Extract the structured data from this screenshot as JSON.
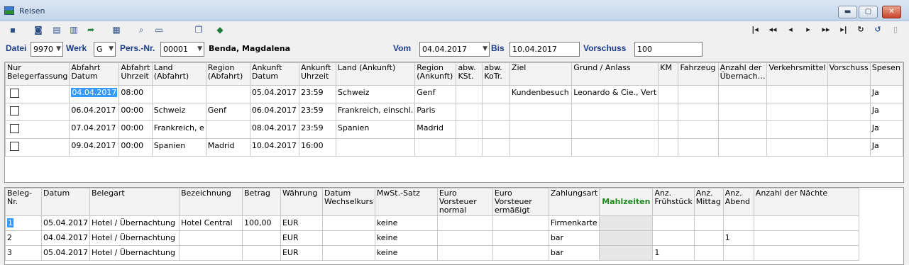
{
  "window": {
    "title": "Reisen",
    "minimize": "▬",
    "maximize": "▢",
    "close": "✕"
  },
  "toolbar": {
    "left_icons": [
      "save-icon",
      "preview-icon",
      "print-icon",
      "print-setup-icon",
      "export-icon",
      "calculator-icon",
      "search-icon",
      "form-icon",
      "copy-icon",
      "book-icon"
    ],
    "nav_icons": [
      "first-record-icon",
      "prev-page-icon",
      "prev-record-icon",
      "next-record-icon",
      "next-page-icon",
      "last-record-icon",
      "refresh-icon",
      "undo-icon",
      "delete-icon"
    ]
  },
  "filter": {
    "datei_label": "Datei",
    "datei_value": "9970",
    "werk_label": "Werk",
    "werk_value": "G",
    "persnr_label": "Pers.-Nr.",
    "persnr_value": "00001",
    "person_name": "Benda, Magdalena",
    "vom_label": "Vom",
    "vom_value": "04.04.2017",
    "bis_label": "Bis",
    "bis_value": "10.04.2017",
    "vorschuss_label": "Vorschuss",
    "vorschuss_value": "100"
  },
  "travel_table": {
    "headers": [
      "Nur Belegerfassung",
      "Abfahrt Datum",
      "Abfahrt Uhrzeit",
      "Land (Abfahrt)",
      "Region (Abfahrt)",
      "Ankunft Datum",
      "Ankunft Uhrzeit",
      "Land (Ankunft)",
      "Region (Ankunft)",
      "abw. KSt.",
      "abw. KoTr.",
      "Ziel",
      "Grund / Anlass",
      "KM",
      "Fahrzeug",
      "Anzahl der Übernach…",
      "Verkehrsmittel",
      "Vorschuss",
      "Spesen"
    ],
    "rows": [
      [
        "",
        "04.04.2017",
        "08:00",
        "",
        "",
        "05.04.2017",
        "23:59",
        "Schweiz",
        "Genf",
        "",
        "",
        "Kundenbesuch",
        "Leonardo & Cie., Vert",
        "",
        "",
        "",
        "",
        "",
        "Ja"
      ],
      [
        "",
        "06.04.2017",
        "00:00",
        "Schweiz",
        "Genf",
        "06.04.2017",
        "23:59",
        "Frankreich, einschl.",
        "Paris",
        "",
        "",
        "",
        "",
        "",
        "",
        "",
        "",
        "",
        "Ja"
      ],
      [
        "",
        "07.04.2017",
        "00:00",
        "Frankreich, e",
        "",
        "08.04.2017",
        "23:59",
        "Spanien",
        "Madrid",
        "",
        "",
        "",
        "",
        "",
        "",
        "",
        "",
        "",
        "Ja"
      ],
      [
        "",
        "09.04.2017",
        "00:00",
        "Spanien",
        "Madrid",
        "10.04.2017",
        "16:00",
        "",
        "",
        "",
        "",
        "",
        "",
        "",
        "",
        "",
        "",
        "",
        "Ja"
      ]
    ]
  },
  "receipt_table": {
    "headers": [
      "Beleg-Nr.",
      "Datum",
      "Belegart",
      "Bezeichnung",
      "Betrag",
      "Währung",
      "Datum Wechselkurs",
      "MwSt.-Satz",
      "Euro Vorsteuer normal",
      "Euro Vorsteuer ermäßigt",
      "Zahlungsart",
      "Mahlzeiten",
      "Anz. Frühstück",
      "Anz. Mittag",
      "Anz. Abend",
      "Anzahl der Nächte"
    ],
    "rows": [
      [
        "1",
        "05.04.2017",
        "Hotel / Übernachtung",
        "Hotel Central",
        "100,00",
        "EUR",
        "",
        "keine",
        "",
        "",
        "Firmenkarte",
        "",
        "",
        "",
        "",
        ""
      ],
      [
        "2",
        "04.04.2017",
        "Hotel / Übernachtung",
        "",
        "",
        "EUR",
        "",
        "keine",
        "",
        "",
        "bar",
        "",
        "",
        "",
        "1",
        ""
      ],
      [
        "3",
        "05.04.2017",
        "Hotel / Übernachtung",
        "",
        "",
        "EUR",
        "",
        "keine",
        "",
        "",
        "bar",
        "",
        "1",
        "",
        "",
        ""
      ]
    ]
  },
  "colors": {
    "label_blue": "#1d3e8c",
    "selection": "#3399ff",
    "mahlzeiten_green": "#1f8a1f"
  }
}
